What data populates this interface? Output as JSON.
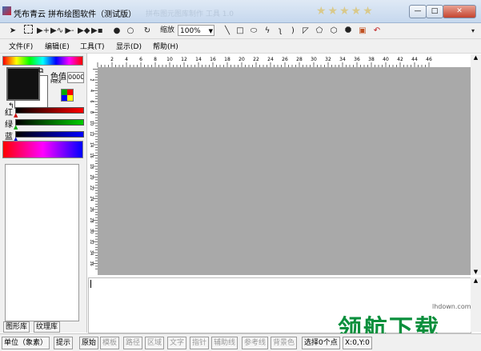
{
  "window": {
    "title": "凭布青云 拼布绘图软件（测试版）",
    "faded_title": "拼布图元图库制作 工具 1.0"
  },
  "window_buttons": {
    "minimize": "—",
    "maximize": "□",
    "close": "✕"
  },
  "toolbar": {
    "zoom_label": "缩放",
    "zoom_value": "100%"
  },
  "menu": {
    "file": "文件(F)",
    "edit": "编辑(E)",
    "tools": "工具(T)",
    "view": "显示(D)",
    "help": "帮助(H)"
  },
  "color_panel": {
    "color_label": "色值",
    "hex_label": "Hex",
    "hex_value": "0000",
    "red": "红",
    "green": "绿",
    "blue": "蓝"
  },
  "library_tabs": [
    "图形库",
    "纹理库"
  ],
  "ruler_top": [
    "2",
    "4",
    "6",
    "8",
    "10",
    "12",
    "14",
    "16",
    "18",
    "20",
    "22",
    "24",
    "26",
    "28",
    "30",
    "32",
    "34",
    "36",
    "38",
    "40",
    "42",
    "44",
    "46"
  ],
  "ruler_left": [
    "2",
    "4",
    "6",
    "8",
    "10",
    "12",
    "14",
    "16",
    "18",
    "20",
    "22",
    "24",
    "26",
    "28",
    "30",
    "32",
    "34",
    "36"
  ],
  "statusbar": {
    "unit": "单位（象素）",
    "hint": "提示",
    "items": [
      "原始",
      "模板",
      "路径",
      "区域",
      "文字",
      "指针",
      "辅助线",
      "参考线",
      "背景色",
      "选择0个点"
    ],
    "coords": "X:0,Y:0"
  },
  "watermark": {
    "text": "领航下载",
    "url": "lhdown.com"
  },
  "colors": {
    "accent": "#0a8f3c",
    "canvas": "#a9a9a9"
  },
  "icons": [
    "select-arrow-icon",
    "marquee-icon",
    "move-point-icon",
    "add-point-icon",
    "delete-point-icon",
    "convert-point-icon",
    "node-icon",
    "zoom-in-icon",
    "zoom-out-icon",
    "rotate-icon",
    "line-icon",
    "rectangle-icon",
    "ellipse-icon",
    "zigzag-icon",
    "s-curve-icon",
    "arc-icon",
    "triangle-icon",
    "pentagon-icon",
    "polygon-icon",
    "octagon-icon",
    "fill-icon",
    "undo-icon"
  ]
}
